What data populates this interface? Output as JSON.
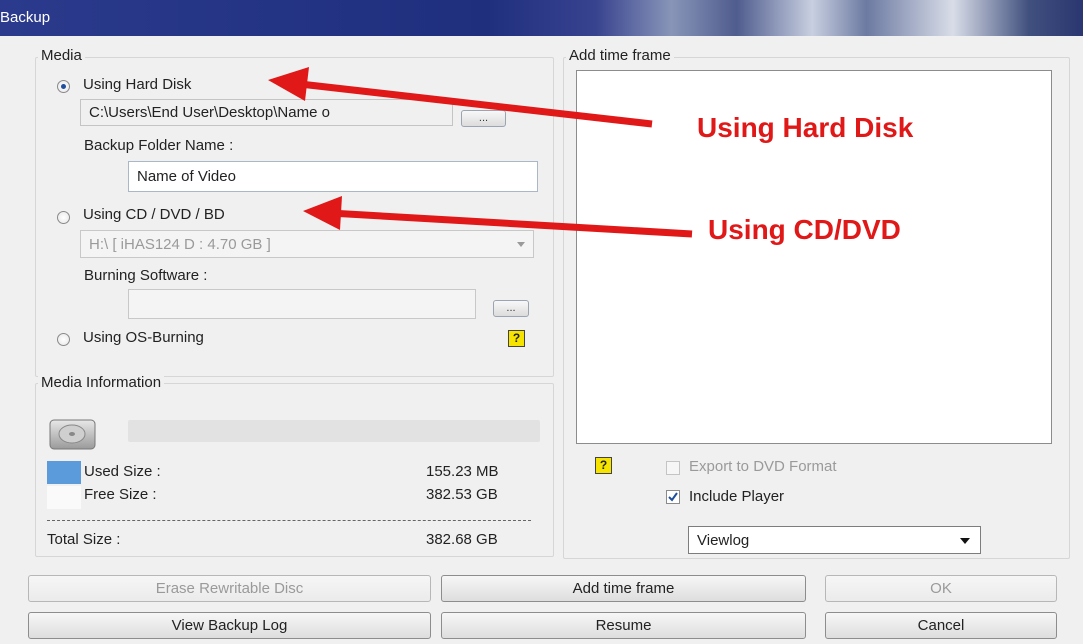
{
  "window": {
    "title": "Backup"
  },
  "media": {
    "legend": "Media",
    "hard_disk": {
      "label": "Using Hard Disk",
      "selected": true,
      "path": "C:\\Users\\End User\\Desktop\\Name o",
      "browse_label": "..."
    },
    "folder": {
      "label": "Backup Folder Name :",
      "value": "Name of Video"
    },
    "cd": {
      "label": "Using CD / DVD / BD",
      "selected": false,
      "drive": "H:\\ [ iHAS124   D      : 4.70 GB ]",
      "burning_label": "Burning Software :",
      "burning_value": "",
      "browse_label": "..."
    },
    "os_burning": {
      "label": "Using OS-Burning",
      "selected": false,
      "help": "?"
    }
  },
  "media_info": {
    "legend": "Media Information",
    "used_label": "Used Size :",
    "used_value": "155.23 MB",
    "free_label": "Free Size :",
    "free_value": "382.53 GB",
    "total_label": "Total Size :",
    "total_value": "382.68 GB",
    "used_color": "#5b9bdc"
  },
  "timeframe": {
    "legend": "Add time frame",
    "help": "?",
    "export_label": "Export to DVD Format",
    "export_checked": false,
    "player_label": "Include Player",
    "player_checked": true,
    "dropdown_value": "Viewlog"
  },
  "buttons": {
    "erase": "Erase Rewritable Disc",
    "add_time_frame": "Add time frame",
    "ok": "OK",
    "view_log": "View Backup Log",
    "resume": "Resume",
    "cancel": "Cancel"
  },
  "annotations": {
    "hard_disk": "Using Hard Disk",
    "cd": "Using CD/DVD",
    "color": "#e01818"
  }
}
